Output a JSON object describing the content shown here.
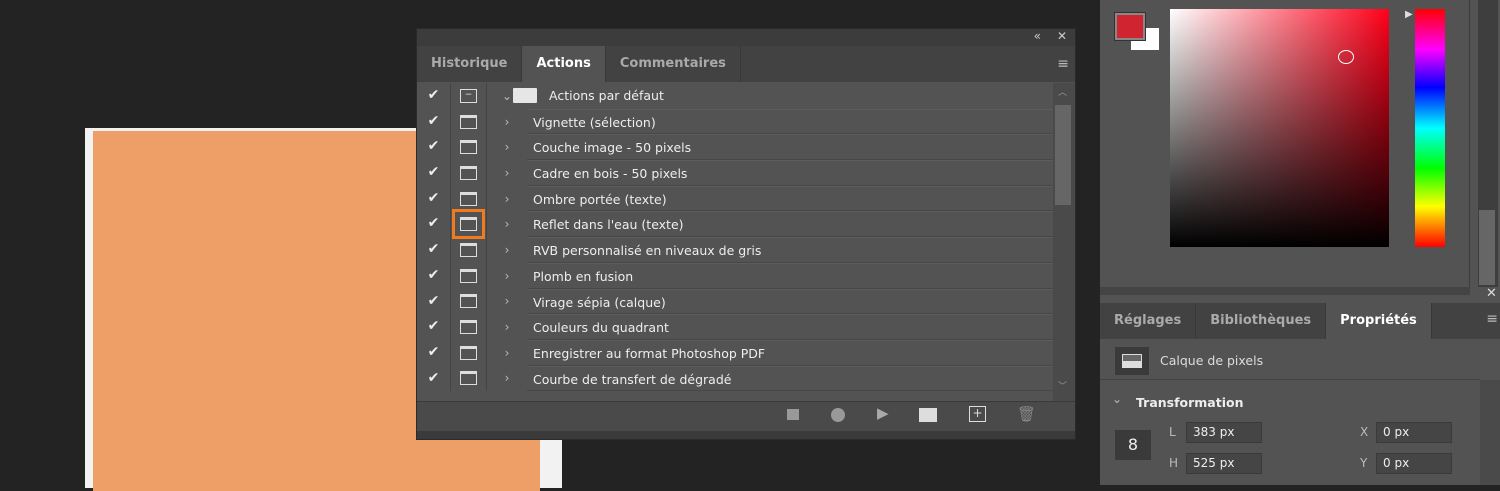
{
  "actions_panel": {
    "collapse_icon": "double-chevron-left-icon",
    "close_icon": "close-icon",
    "tabs": [
      {
        "label": "Historique"
      },
      {
        "label": "Actions",
        "active": true
      },
      {
        "label": "Commentaires"
      }
    ],
    "set_name": "Actions par défaut",
    "items": [
      {
        "label": "Vignette (sélection)"
      },
      {
        "label": "Couche image - 50 pixels"
      },
      {
        "label": "Cadre en bois - 50 pixels"
      },
      {
        "label": "Ombre portée (texte)"
      },
      {
        "label": "Reflet dans l'eau (texte)",
        "highlighted": true
      },
      {
        "label": "RVB personnalisé en niveaux de gris"
      },
      {
        "label": "Plomb en fusion"
      },
      {
        "label": "Virage sépia (calque)"
      },
      {
        "label": "Couleurs du quadrant"
      },
      {
        "label": "Enregistrer au format Photoshop PDF"
      },
      {
        "label": "Courbe de transfert de dégradé"
      }
    ],
    "footer_icons": [
      "stop-icon",
      "record-icon",
      "play-icon",
      "new-set-folder-icon",
      "new-action-icon",
      "trash-icon"
    ]
  },
  "color_panel": {
    "foreground": "#d02530",
    "background": "#ffffff"
  },
  "right_tabs": [
    {
      "label": "Réglages"
    },
    {
      "label": "Bibliothèques"
    },
    {
      "label": "Propriétés",
      "active": true
    }
  ],
  "properties": {
    "layer_type": "Calque de pixels",
    "section": "Transformation",
    "w_label": "L",
    "w_value": "383 px",
    "h_label": "H",
    "h_value": "525 px",
    "x_label": "X",
    "x_value": "0 px",
    "y_label": "Y",
    "y_value": "0 px"
  },
  "document": {
    "fill_color": "#ee9f68"
  }
}
